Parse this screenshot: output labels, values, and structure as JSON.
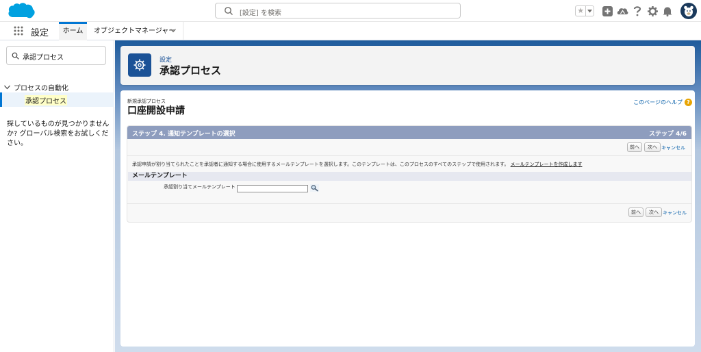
{
  "header": {
    "search_placeholder": "[設定] を検索",
    "icons": [
      "favorites-star-icon",
      "favorites-dropdown-icon",
      "global-actions-icon",
      "trailhead-icon",
      "help-icon",
      "setup-gear-icon",
      "notifications-bell-icon",
      "user-avatar-icon"
    ]
  },
  "nav": {
    "app_name": "設定",
    "tabs": [
      {
        "label": "ホーム",
        "active": true
      },
      {
        "label": "オブジェクトマネージャー",
        "active": false
      }
    ]
  },
  "sidebar": {
    "quick_find_value": "承認プロセス",
    "tree_parent": "プロセスの自動化",
    "tree_child": "承認プロセス",
    "not_found_text": "探しているものが見つかりませんか? グローバル検索をお試しください。"
  },
  "page_header": {
    "subtitle": "設定",
    "title": "承認プロセス"
  },
  "content": {
    "breadcrumb": "新規承認プロセス",
    "title": "口座開設申請",
    "help_link": "このページのヘルプ",
    "step_title": "ステップ 4. 通知テンプレートの選択",
    "step_counter": "ステップ 4/6",
    "buttons": {
      "prev": "前へ",
      "next": "次へ",
      "cancel": "キャンセル"
    },
    "description": "承認申請が割り当てられたことを承認者に通知する場合に使用するメールテンプレートを選択します。このテンプレートは、このプロセスのすべてのステップで使用されます。",
    "create_link": "メールテンプレートを作成します",
    "section_title": "メールテンプレート",
    "field_label": "承認割り当てメールテンプレート",
    "field_value": ""
  },
  "colors": {
    "brand_blue": "#0176d3",
    "header_icon_bg": "#1b5297",
    "step_bar": "#8e9dbe",
    "help_icon": "#e8a402"
  }
}
